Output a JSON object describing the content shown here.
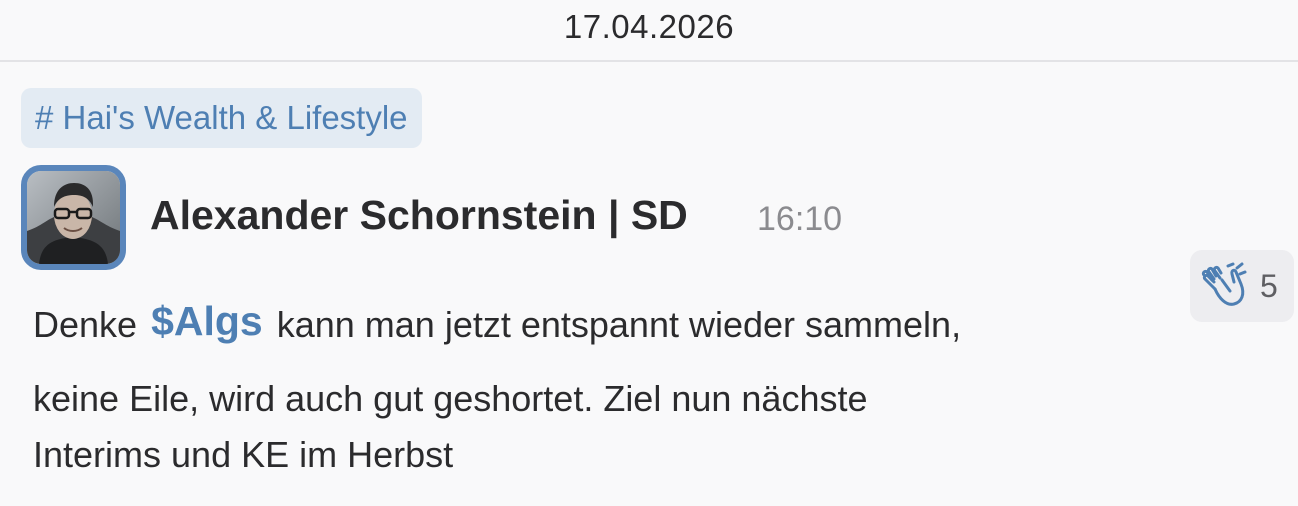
{
  "date_header": "17.04.2026",
  "channel": {
    "label": "# Hai's Wealth & Lifestyle"
  },
  "message": {
    "author": "Alexander Schornstein | SD",
    "time": "16:10",
    "avatar_icon": "user-photo",
    "text_parts": {
      "before_ticker": "Denke",
      "ticker": "$Algs",
      "after_ticker": "kann man jetzt entspannt wieder sammeln,",
      "line2": "keine Eile, wird auch gut geshortet. Ziel nun nächste",
      "line3": "Interims und KE im Herbst"
    },
    "reaction": {
      "icon": "clapping-hands-icon",
      "count": "5"
    }
  },
  "colors": {
    "accent": "#4e7fb3",
    "avatar_border": "#5a86bb",
    "tag_background": "#e3ebf3",
    "reaction_background": "#ededf0"
  }
}
